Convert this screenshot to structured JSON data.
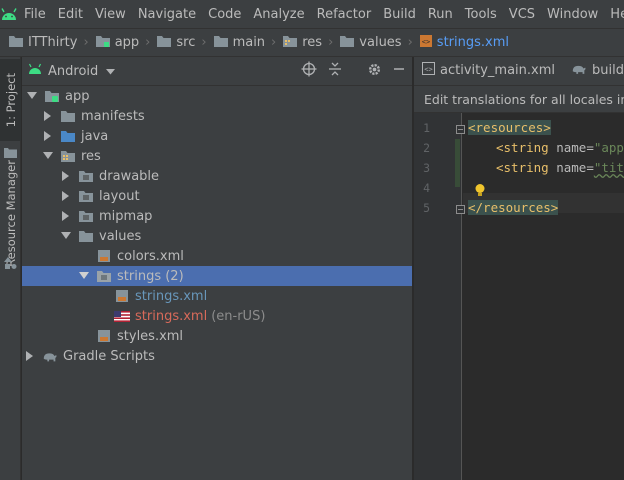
{
  "menu": [
    "File",
    "Edit",
    "View",
    "Navigate",
    "Code",
    "Analyze",
    "Refactor",
    "Build",
    "Run",
    "Tools",
    "VCS",
    "Window",
    "Help"
  ],
  "breadcrumb": [
    "ITThirty",
    "app",
    "src",
    "main",
    "res",
    "values",
    "strings.xml"
  ],
  "toolwindows": {
    "project": "1: Project",
    "resource_manager": "Resource Manager"
  },
  "project_panel": {
    "view_mode": "Android",
    "tree": [
      {
        "label": "app",
        "suffix": ""
      },
      {
        "label": "manifests",
        "suffix": ""
      },
      {
        "label": "java",
        "suffix": ""
      },
      {
        "label": "res",
        "suffix": ""
      },
      {
        "label": "drawable",
        "suffix": ""
      },
      {
        "label": "layout",
        "suffix": ""
      },
      {
        "label": "mipmap",
        "suffix": ""
      },
      {
        "label": "values",
        "suffix": ""
      },
      {
        "label": "colors.xml",
        "suffix": ""
      },
      {
        "label": "strings (2)",
        "suffix": ""
      },
      {
        "label": "strings.xml",
        "suffix": ""
      },
      {
        "label": "strings.xml",
        "suffix": "(en-rUS)"
      },
      {
        "label": "styles.xml",
        "suffix": ""
      },
      {
        "label": "Gradle Scripts",
        "suffix": ""
      }
    ]
  },
  "editor": {
    "tabs": [
      "activity_main.xml",
      "build.g"
    ],
    "notification": "Edit translations for all locales in the",
    "line_numbers": [
      "1",
      "2",
      "3",
      "4",
      "5"
    ],
    "code": {
      "l1_open": "<resources>",
      "l2_tag": "<string",
      "l2_attr": "name=",
      "l2_val": "\"app_",
      "l3_tag": "<string",
      "l3_attr": "name=",
      "l3_val": "\"titl",
      "l5_close": "</resources>"
    }
  },
  "colors": {
    "accent": "#4b6eaf",
    "background": "#2b2b2b",
    "panel": "#3c3f41",
    "android_green": "#3ddc84",
    "xml_tag": "#e8bf6a"
  }
}
